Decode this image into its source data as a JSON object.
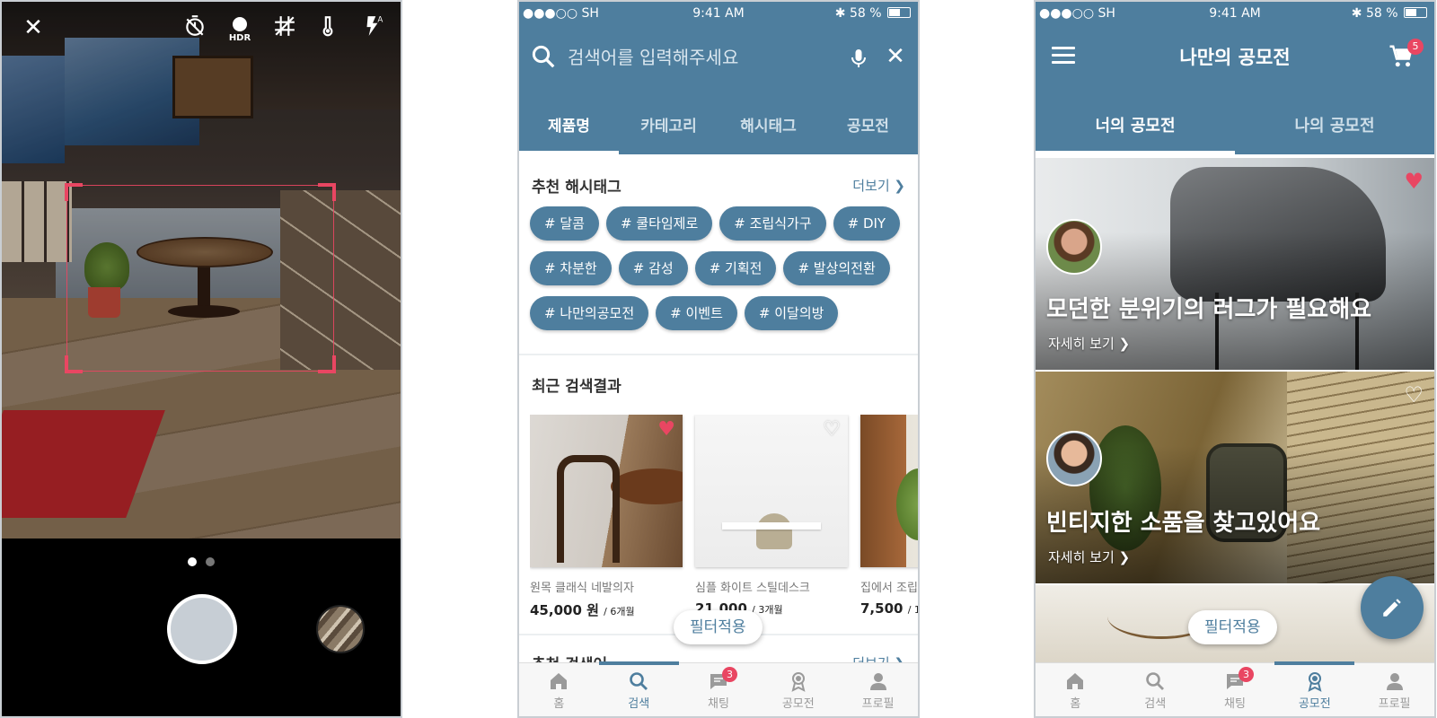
{
  "camera": {
    "close_icon": "close-icon",
    "toolbar_icons": [
      "timer-icon",
      "hdr-icon",
      "grid-icon",
      "temperature-icon",
      "flash-auto-icon"
    ],
    "hdr_label": "HDR",
    "page_dots": 2,
    "page_active": 1
  },
  "status_bar": {
    "carrier": "●●●○○ SH",
    "time": "9:41 AM",
    "battery": "58 %"
  },
  "search_screen": {
    "placeholder": "검색어를 입력해주세요",
    "tabs": [
      "제품명",
      "카테고리",
      "해시태그",
      "공모전"
    ],
    "active_tab": 0,
    "recommended_hashtags_title": "추천 해시태그",
    "more_label": "더보기",
    "hashtags": [
      "# 달콤",
      "# 쿨타임제로",
      "# 조립식가구",
      "# DIY",
      "# 차분한",
      "# 감성",
      "# 기획전",
      "# 발상의전환",
      "# 나만의공모전",
      "# 이벤트",
      "# 이달의방"
    ],
    "recent_results_title": "최근 검색결과",
    "results": [
      {
        "name": "원목 클래식 네발의자",
        "price": "45,000 원",
        "period": "/ 6개월",
        "liked": true
      },
      {
        "name": "심플 화이트 스틸데스크",
        "price": "21,000",
        "period": "/ 3개월",
        "liked": false
      },
      {
        "name": "집에서 조립",
        "price": "7,500",
        "period": "/ 1",
        "liked": false
      }
    ],
    "filter_button": "필터적용",
    "recommended_search_title": "추천 검색어",
    "more_label_2": "더보기"
  },
  "bottom_nav": {
    "items": [
      "홈",
      "검색",
      "채팅",
      "공모전",
      "프로필"
    ],
    "chat_badge": "3"
  },
  "contest_screen": {
    "title": "나만의 공모전",
    "cart_badge": "5",
    "tabs": [
      "너의 공모전",
      "나의 공모전"
    ],
    "active_tab": 0,
    "banners": [
      {
        "title": "모던한 분위기의 러그가 필요해요",
        "link": "자세히 보기",
        "liked": true
      },
      {
        "title": "빈티지한 소품을 찾고있어요",
        "link": "자세히 보기",
        "liked": false
      }
    ],
    "filter_button": "필터적용",
    "fab_icon": "pencil-icon"
  },
  "colors": {
    "primary": "#4e7e9e",
    "accent": "#e94662",
    "nav_inactive": "#9a9a9a"
  }
}
